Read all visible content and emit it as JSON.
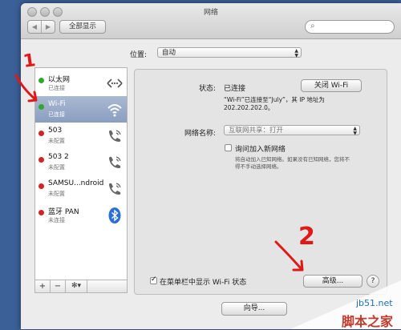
{
  "window": {
    "title": "网络"
  },
  "toolbar": {
    "back": "◀",
    "forward": "▶",
    "show_all": "全部显示",
    "search_placeholder": ""
  },
  "location": {
    "label": "位置:",
    "value": "自动"
  },
  "services": [
    {
      "name": "以太网",
      "status": "已连接",
      "dot": "#2fa82f",
      "icon": "ethernet-icon"
    },
    {
      "name": "Wi-Fi",
      "status": "已连接",
      "dot": "#2fa82f",
      "icon": "wifi-icon"
    },
    {
      "name": "503",
      "status": "未配置",
      "dot": "#d32323",
      "icon": "phone-icon"
    },
    {
      "name": "503 2",
      "status": "未配置",
      "dot": "#d32323",
      "icon": "phone-icon"
    },
    {
      "name": "SAMSU...ndroid",
      "status": "未配置",
      "dot": "#d32323",
      "icon": "phone-icon"
    },
    {
      "name": "蓝牙 PAN",
      "status": "未连接",
      "dot": "#d32323",
      "icon": "bluetooth-icon"
    }
  ],
  "sidebar_buttons": {
    "add": "+",
    "remove": "−",
    "gear": "✻▾"
  },
  "detail": {
    "status_label": "状态:",
    "status_value": "已连接",
    "toggle_wifi": "关闭 Wi-Fi",
    "status_desc_1": "“Wi-Fi”已连接至“July”，其 IP 地址为",
    "status_desc_2": "202.202.202.0。",
    "network_name_label": "网络名称:",
    "network_name_value": "互联网共享：打开",
    "ask_join_label": "询问加入新网络",
    "ask_join_desc_1": "将自动加入已知网络。如果没有已知网络，您将不",
    "ask_join_desc_2": "得不手动选择网络。",
    "show_menubar_label": "在菜单栏中显示 Wi-Fi 状态",
    "advanced": "高级...",
    "help": "?"
  },
  "footer": {
    "assistant": "向导..."
  },
  "annotations": {
    "one": "1",
    "two": "2"
  },
  "watermark": {
    "site": "jb51.net",
    "brand": "脚本之家"
  },
  "colors": {
    "desktop": "#3b5f97",
    "selection": "#8a9ebf",
    "arrow": "#e01818"
  }
}
